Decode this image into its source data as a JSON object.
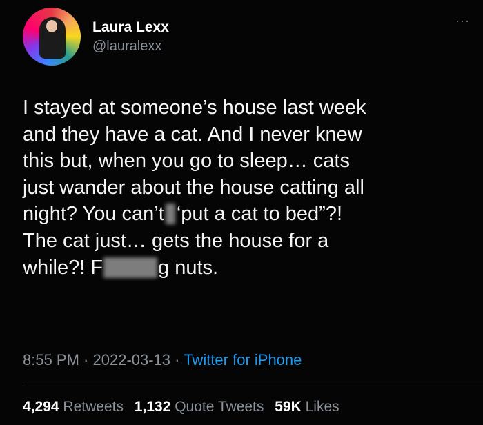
{
  "author": {
    "name": "Laura Lexx",
    "handle": "@lauralexx"
  },
  "more_label": "···",
  "body_lines": {
    "l1": "I stayed at someone’s house last week",
    "l2": "and they have a cat. And I never knew",
    "l3": "this but, when you go to sleep… cats",
    "l4": "just wander about the house catting all",
    "l5a": "night? You can’t",
    "l5b": "‘put a cat to bed”?!",
    "l6": "The cat just… gets the house for a",
    "l7a": "while?! F",
    "l7b": "g nuts."
  },
  "meta": {
    "time": "8:55 PM",
    "sep1": " · ",
    "date": "2022-03-13",
    "sep2": " · ",
    "source": "Twitter for iPhone"
  },
  "stats": {
    "retweets_count": "4,294",
    "retweets_label": "Retweets",
    "quotes_count": "1,132",
    "quotes_label": "Quote Tweets",
    "likes_count": "59K",
    "likes_label": "Likes"
  },
  "colors": {
    "background": "#050505",
    "link": "#1d9bf0",
    "muted": "#8b9299"
  }
}
